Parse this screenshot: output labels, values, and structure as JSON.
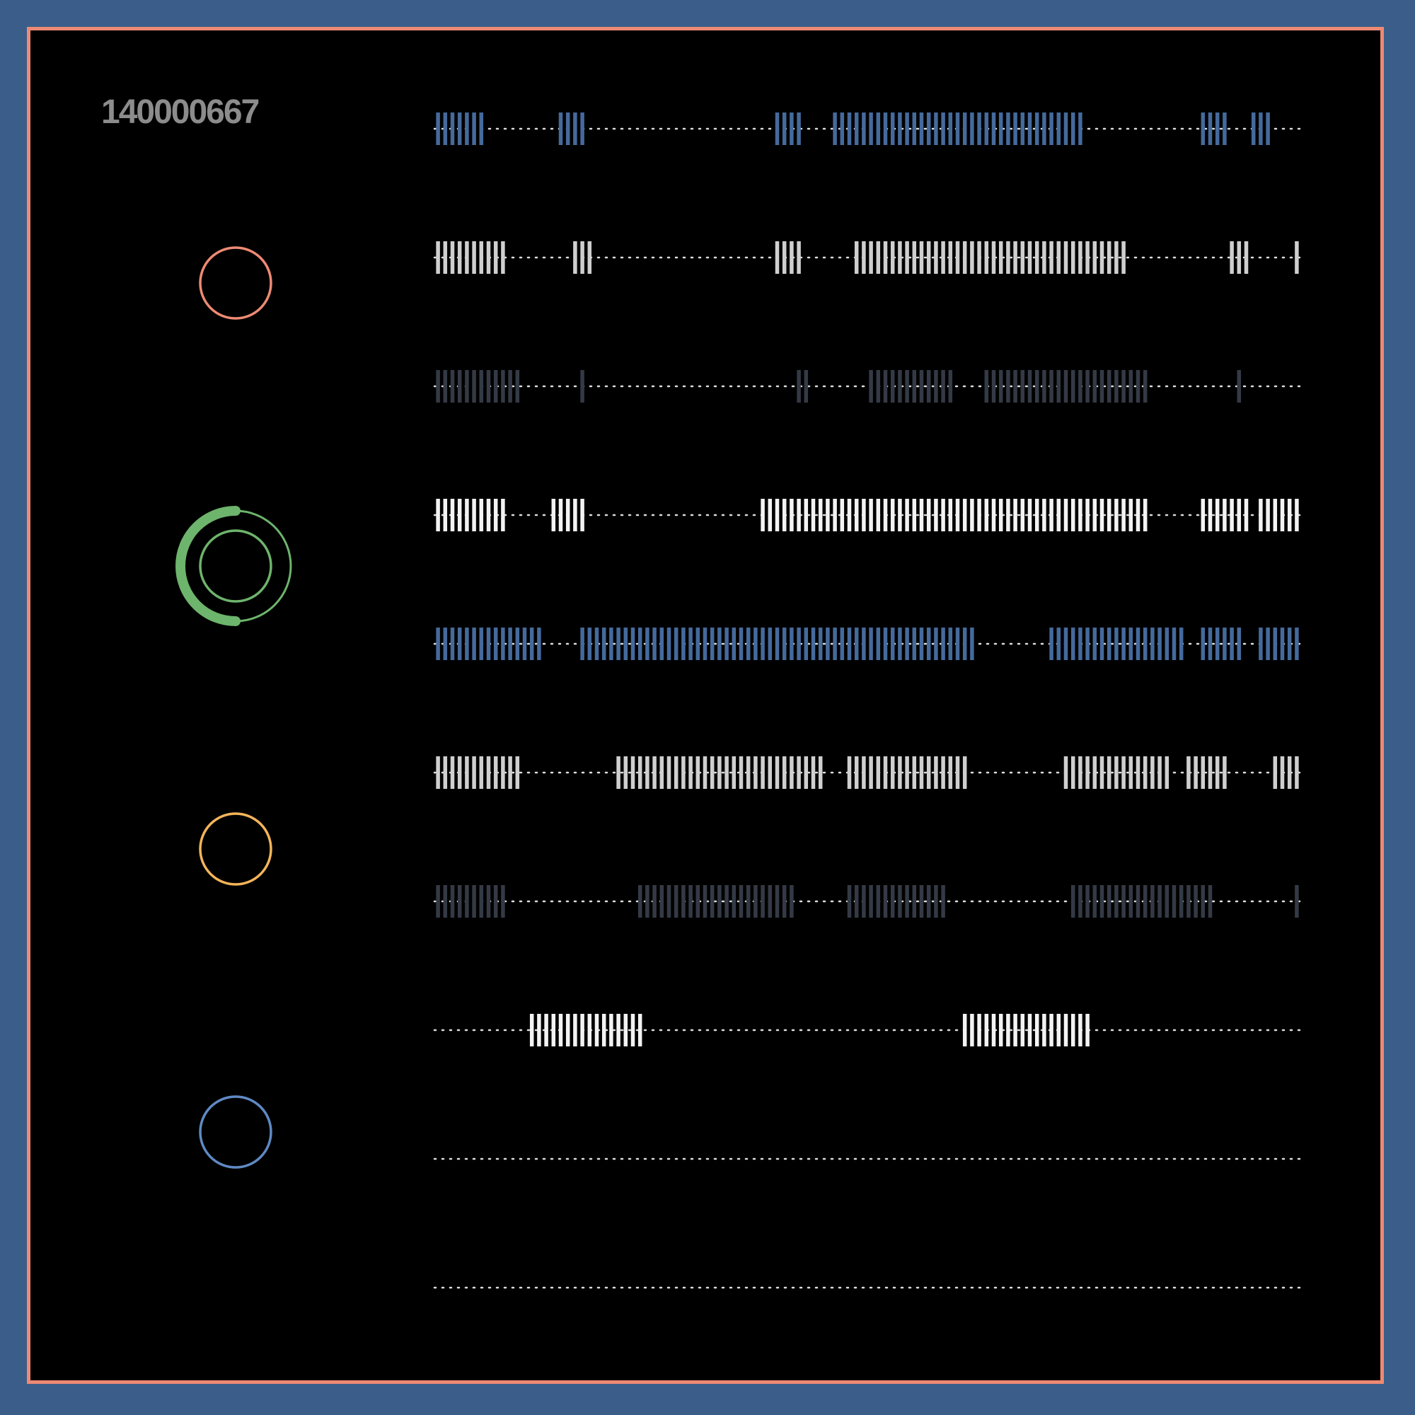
{
  "header": {
    "id": "140000667"
  },
  "colors": {
    "background": "#000000",
    "outer": "#3a5e89",
    "frame_border": "#ee8a74",
    "label": "#8c8c8c",
    "dots": "#dddddd",
    "blue": "#456a9c",
    "light": "#cfcfcf",
    "dark": "#343a45",
    "white": "#f3f3f3"
  },
  "indicators": [
    {
      "name": "ring-salmon",
      "color": "#ee8a74",
      "progress": 0
    },
    {
      "name": "ring-green",
      "color": "#6db46c",
      "progress": 0.5
    },
    {
      "name": "ring-orange",
      "color": "#f4b45a",
      "progress": 0
    },
    {
      "name": "ring-blue",
      "color": "#5f8ac4",
      "progress": 0
    }
  ],
  "tracks": [
    {
      "color": "blue",
      "bars": [
        [
          0,
          7
        ],
        [
          17,
          21
        ],
        [
          47,
          51
        ],
        [
          55,
          90
        ],
        [
          106,
          110
        ],
        [
          113,
          116
        ]
      ]
    },
    {
      "color": "light",
      "bars": [
        [
          0,
          10
        ],
        [
          19,
          22
        ],
        [
          47,
          51
        ],
        [
          58,
          96
        ],
        [
          110,
          113
        ],
        [
          119,
          120
        ]
      ]
    },
    {
      "color": "dark",
      "bars": [
        [
          0,
          12
        ],
        [
          20,
          21
        ],
        [
          50,
          52
        ],
        [
          60,
          72
        ],
        [
          76,
          99
        ],
        [
          111,
          112
        ]
      ]
    },
    {
      "color": "white",
      "bars": [
        [
          0,
          10
        ],
        [
          16,
          21
        ],
        [
          45,
          99
        ],
        [
          106,
          113
        ],
        [
          114,
          120
        ]
      ]
    },
    {
      "color": "blue",
      "bars": [
        [
          0,
          15
        ],
        [
          20,
          75
        ],
        [
          85,
          104
        ],
        [
          106,
          112
        ],
        [
          114,
          120
        ]
      ]
    },
    {
      "color": "light",
      "bars": [
        [
          0,
          12
        ],
        [
          25,
          54
        ],
        [
          57,
          74
        ],
        [
          87,
          102
        ],
        [
          104,
          110
        ],
        [
          116,
          120
        ]
      ]
    },
    {
      "color": "dark",
      "bars": [
        [
          0,
          10
        ],
        [
          28,
          50
        ],
        [
          57,
          71
        ],
        [
          88,
          108
        ],
        [
          119,
          120
        ]
      ]
    },
    {
      "color": "white",
      "bars": [
        [
          13,
          29
        ],
        [
          73,
          91
        ]
      ]
    },
    {
      "color": "white",
      "bars": []
    },
    {
      "color": "white",
      "bars": []
    }
  ]
}
